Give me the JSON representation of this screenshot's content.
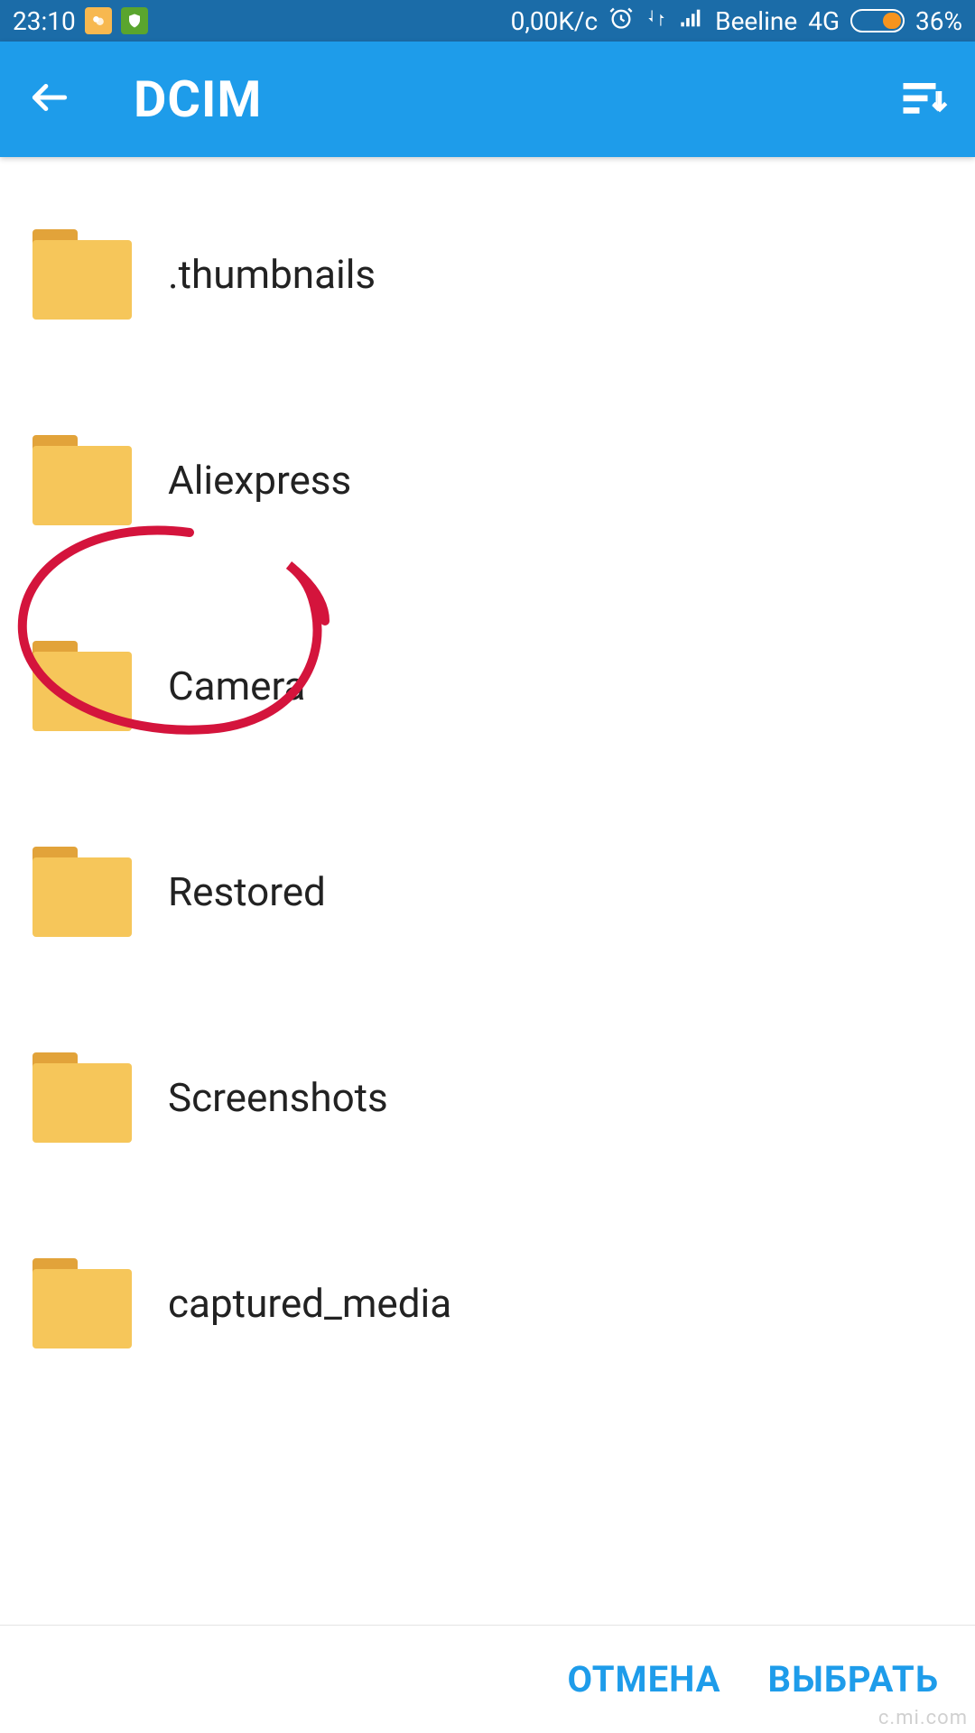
{
  "status_bar": {
    "time": "23:10",
    "data_rate": "0,00K/c",
    "carrier": "Beeline",
    "network": "4G",
    "battery_pct": "36%"
  },
  "header": {
    "title": "DCIM"
  },
  "folders": [
    {
      "name": ".thumbnails"
    },
    {
      "name": "Aliexpress"
    },
    {
      "name": "Camera"
    },
    {
      "name": "Restored"
    },
    {
      "name": "Screenshots"
    },
    {
      "name": "captured_media"
    }
  ],
  "footer": {
    "cancel_label": "ОТМЕНА",
    "select_label": "ВЫБРАТЬ"
  },
  "watermark": "c.mi.com"
}
